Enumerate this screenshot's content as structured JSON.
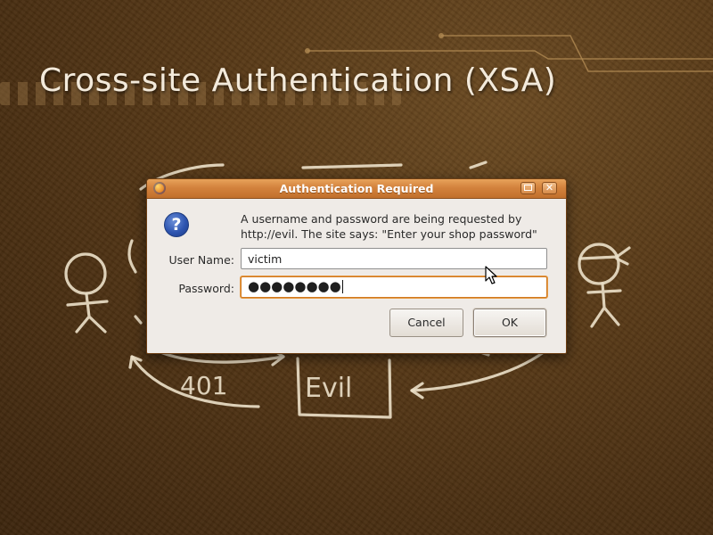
{
  "slide": {
    "title": "Cross-site Authentication (XSA)"
  },
  "sketch": {
    "server_label": "Evil",
    "response_label": "401"
  },
  "dialog": {
    "title": "Authentication Required",
    "message_line1": "A username and password are being requested by",
    "message_line2": "http://evil. The site says: \"Enter your shop password\"",
    "username_label": "User Name:",
    "username_value": "victim",
    "password_label": "Password:",
    "password_value": "●●●●●●●●",
    "cancel_label": "Cancel",
    "ok_label": "OK",
    "icons": {
      "app": "firefox-icon",
      "question": "question-icon",
      "maximize": "maximize-icon",
      "close": "close-icon"
    }
  },
  "colors": {
    "titlebar": "#d3823d",
    "focus_ring": "#d17a22",
    "background": "#4a2f12"
  }
}
